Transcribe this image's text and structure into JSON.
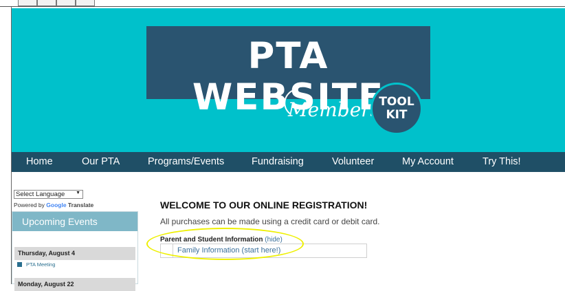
{
  "banner": {
    "title": "PTA WEBSITE",
    "script_text": "Membership",
    "badge_line1": "TOOL",
    "badge_line2": "KIT",
    "colors": {
      "background": "#00c1cb",
      "logo_box": "#2a5470",
      "nav": "#1f4f66"
    }
  },
  "nav": {
    "items": [
      "Home",
      "Our PTA",
      "Programs/Events",
      "Fundraising",
      "Volunteer",
      "My Account",
      "Try This!"
    ]
  },
  "translate": {
    "select_value": "Select Language",
    "powered_by": "Powered by",
    "google": "Google",
    "translate": "Translate"
  },
  "sidebar": {
    "header": "Upcoming Events",
    "dates": [
      "Thursday, August 4",
      "Monday, August 22"
    ],
    "events": [
      "PTA Meeting"
    ]
  },
  "main": {
    "heading": "WELCOME TO OUR ONLINE REGISTRATION!",
    "subtext": "All purchases can be made using a credit card or debit card.",
    "section_label": "Parent and Student Information",
    "hide_link": "(hide)",
    "family_link": "Family Information (start here!)"
  }
}
